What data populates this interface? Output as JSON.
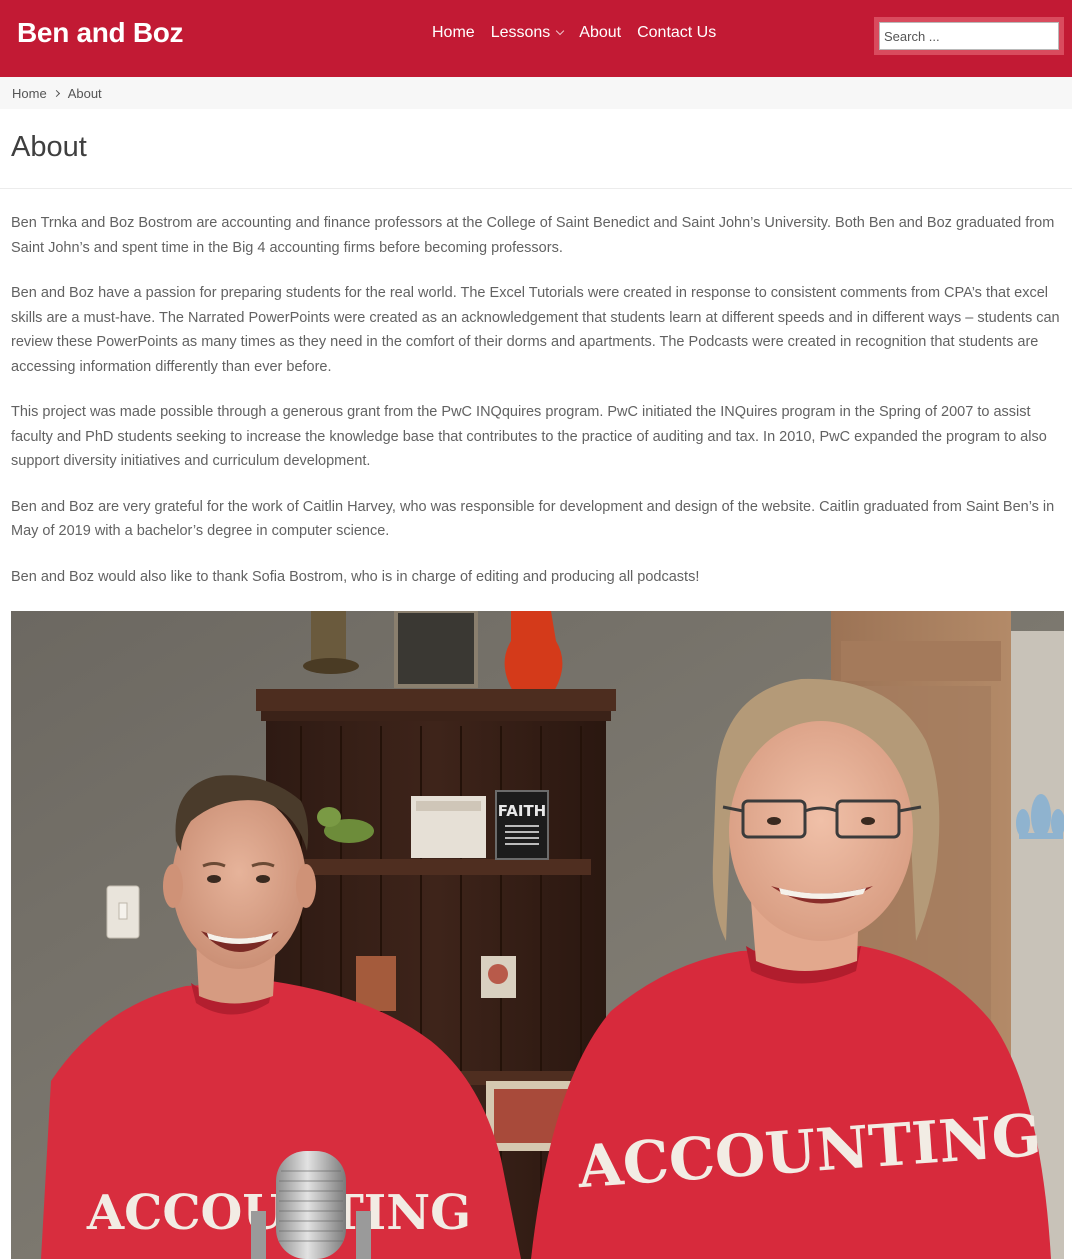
{
  "header": {
    "site_title": "Ben and Boz",
    "nav": [
      {
        "label": "Home"
      },
      {
        "label": "Lessons",
        "has_dropdown": true
      },
      {
        "label": "About"
      },
      {
        "label": "Contact Us"
      }
    ],
    "search_placeholder": "Search ..."
  },
  "breadcrumb": {
    "home": "Home",
    "current": "About"
  },
  "page": {
    "title": "About",
    "paragraphs": [
      "Ben Trnka and Boz Bostrom are accounting and finance professors at the College of Saint Benedict and Saint John’s University. Both Ben and Boz graduated from Saint John’s and spent time in the Big 4 accounting firms before becoming professors.",
      "Ben and Boz have a passion for preparing students for the real world. The Excel Tutorials were created in response to consistent comments from CPA’s that excel skills are a must-have. The Narrated PowerPoints were created as an acknowledgement that students learn at different speeds and in different ways – students can review these PowerPoints as many times as they need in the comfort of their dorms and apartments. The Podcasts were created in recognition that students are accessing information differently than ever before.",
      "This project was made possible through a generous grant from the PwC INQquires program. PwC initiated the INQuires program in the Spring of 2007 to assist faculty and PhD students seeking to increase the knowledge base that contributes to the practice of auditing and tax. In 2010, PwC expanded the program to also support diversity initiatives and curriculum development.",
      "Ben and Boz are very grateful for the work of Caitlin Harvey, who was responsible for development and design of the website. Caitlin graduated from Saint Ben’s in May of 2019 with a bachelor’s degree in computer science.",
      "Ben and Boz would also like to thank Sofia Bostrom, who is in charge of editing and producing all podcasts!"
    ],
    "photo": {
      "sign_text": "FAITH",
      "shirt_text_left": "ACCOUNTING",
      "shirt_text_right": "ACCOUNTING"
    }
  },
  "colors": {
    "brand_red": "#c21a34",
    "breadcrumb_bg": "#f7f7f7",
    "body_text": "#626262"
  }
}
